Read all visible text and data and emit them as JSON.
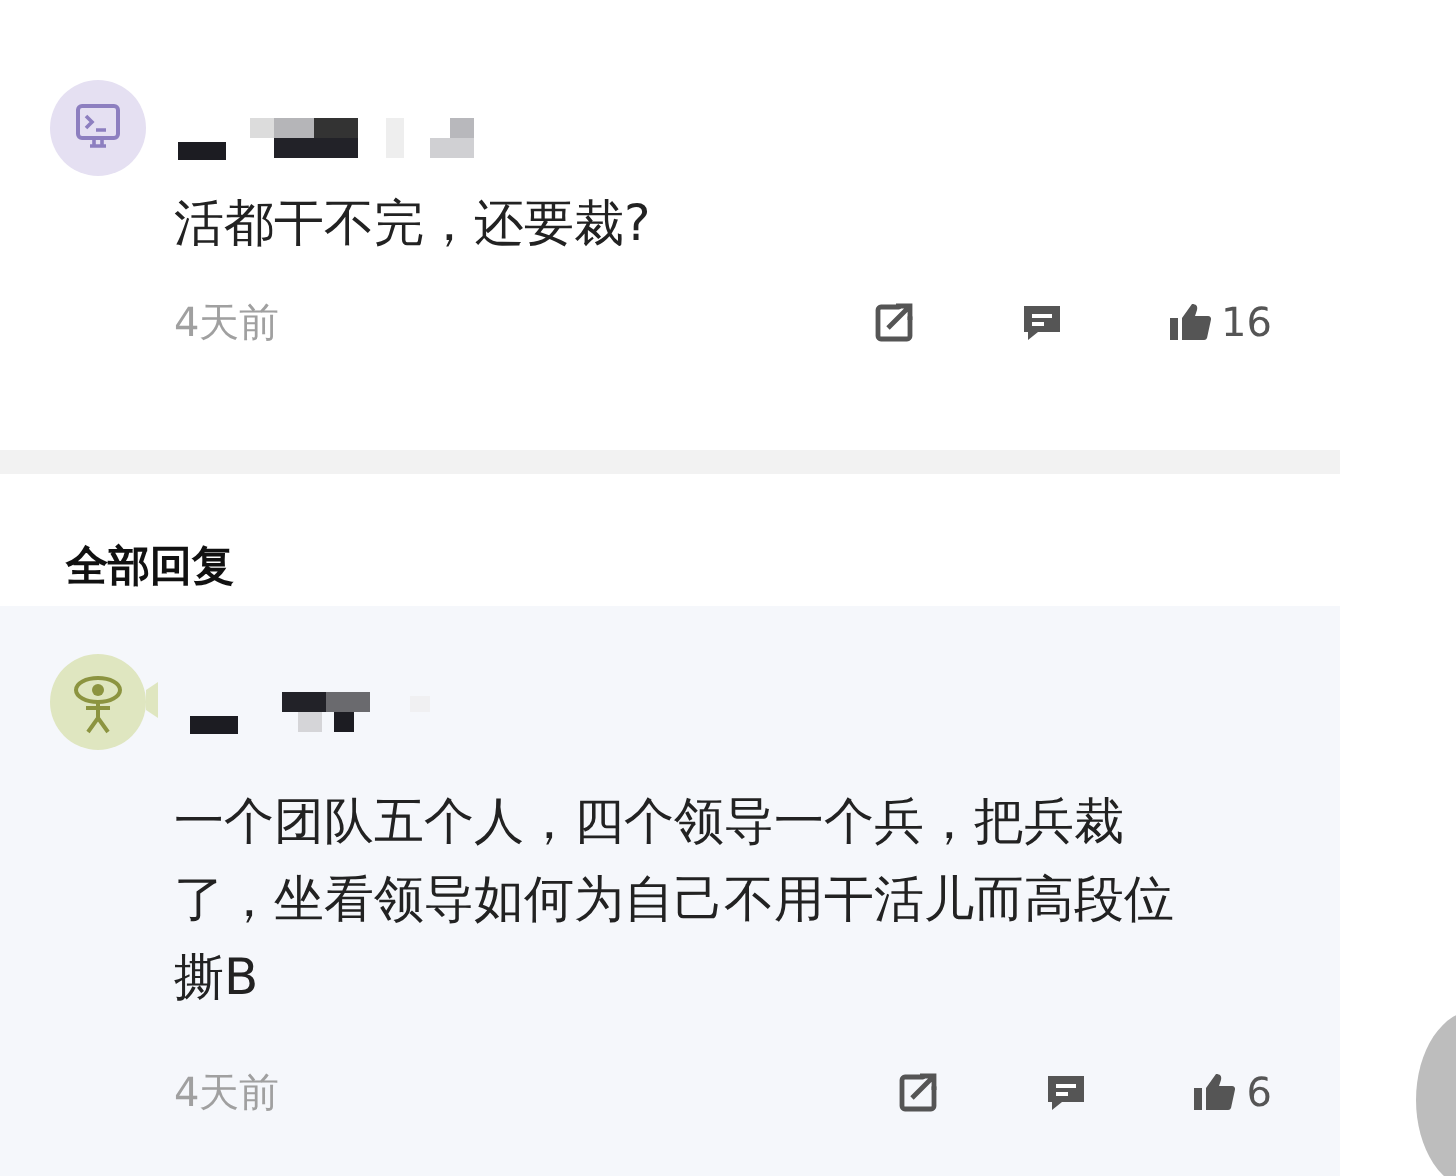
{
  "comment": {
    "text": "活都干不完，还要裁?",
    "time": "4天前",
    "likes": "16"
  },
  "replies_header": "全部回复",
  "replies": [
    {
      "text": "一个团队五个人，四个领导一个兵，把兵裁了，坐看领导如何为自己不用干活儿而高段位撕B",
      "time": "4天前",
      "likes": "6"
    }
  ]
}
